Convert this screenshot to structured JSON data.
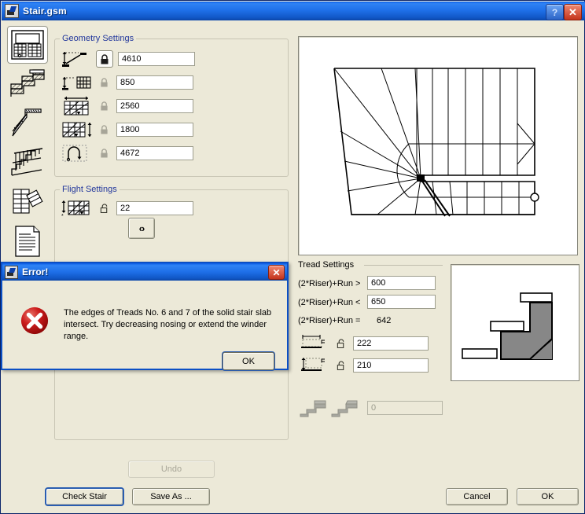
{
  "window": {
    "title": "Stair.gsm",
    "icon": "stair-app-icon",
    "help_button": "?",
    "close_button": "✕"
  },
  "sidebar": {
    "items": [
      {
        "name": "plan-view",
        "label": "Plan View",
        "selected": true
      },
      {
        "name": "section-view",
        "label": "Section View",
        "selected": false
      },
      {
        "name": "stringer-profile",
        "label": "Stringer Profile",
        "selected": false
      },
      {
        "name": "railing-settings",
        "label": "Railing Settings",
        "selected": false
      },
      {
        "name": "winder-settings",
        "label": "Winder Settings",
        "selected": false
      },
      {
        "name": "listing-document",
        "label": "Listing",
        "selected": false
      }
    ]
  },
  "geometry": {
    "legend": "Geometry Settings",
    "rows": [
      {
        "icon": "stair-height-icon",
        "lock": "locked-active",
        "value": "4610",
        "disabled": true
      },
      {
        "icon": "stair-headroom-icon",
        "lock": "locked",
        "value": "850",
        "disabled": true
      },
      {
        "icon": "stair-width-icon",
        "lock": "locked",
        "value": "2560",
        "disabled": true
      },
      {
        "icon": "stair-depth-icon",
        "lock": "locked",
        "value": "1800",
        "disabled": true
      },
      {
        "icon": "walking-line-icon",
        "lock": "locked",
        "value": "4672",
        "disabled": true
      }
    ]
  },
  "flight": {
    "legend": "Flight Settings",
    "icon": "flight-risers-icon",
    "lock": "unlocked",
    "value": "22",
    "nav_button": "‹›"
  },
  "tread": {
    "title": "Tread Settings",
    "rule_min_label": "(2*Riser)+Run >",
    "rule_min_value": "600",
    "rule_max_label": "(2*Riser)+Run <",
    "rule_max_value": "650",
    "rule_actual_label": "(2*Riser)+Run =",
    "rule_actual_value": "642",
    "run_icon": "tread-run-icon",
    "run_lock": "unlocked",
    "run_value": "222",
    "riser_icon": "tread-riser-icon",
    "riser_lock": "unlocked",
    "riser_value": "210",
    "nosing_icon_left": "stair-nosing-a-icon",
    "nosing_icon_right": "stair-nosing-b-icon",
    "nosing_value": "0",
    "nosing_disabled": true
  },
  "preview": {
    "plan_name": "stair-plan-preview",
    "detail_name": "stair-detail-preview"
  },
  "buttons": {
    "undo": "Undo",
    "check_stair": "Check Stair",
    "save_as": "Save As ...",
    "cancel": "Cancel",
    "ok": "OK"
  },
  "error_dialog": {
    "title": "Error!",
    "close_button": "✕",
    "icon": "error-cross-icon",
    "message": "The edges of Treads No. 6 and 7 of the solid stair slab intersect. Try decreasing nosing or extend the winder range.",
    "ok": "OK"
  },
  "colors": {
    "window_face": "#ece9d8",
    "titlebar_blue": "#1e6fe8",
    "legend_blue": "#22379c",
    "error_red": "#c4341c",
    "focus_blue": "#2a5db0"
  }
}
